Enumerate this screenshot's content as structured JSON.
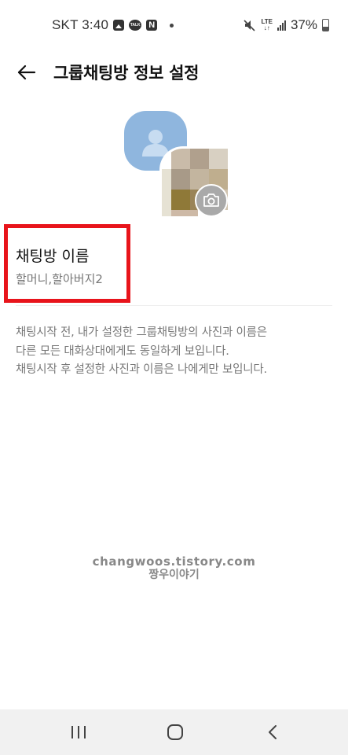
{
  "status_bar": {
    "carrier_time": "SKT 3:40",
    "talk_badge": "TALK",
    "n_badge": "N",
    "network": "LTE",
    "battery": "37%",
    "icons": [
      "gallery-icon",
      "talk-icon",
      "n-icon",
      "mute-icon",
      "lte-icon",
      "signal-icon",
      "battery-icon"
    ]
  },
  "app_bar": {
    "back_icon": "arrow-left-icon",
    "title": "그룹채팅방 정보 설정"
  },
  "profile": {
    "member_icon": "default-profile-icon",
    "camera_icon": "camera-icon"
  },
  "name_field": {
    "label": "채팅방 이름",
    "value": "할머니,할아버지2",
    "highlight_color": "#e8141b"
  },
  "notice": {
    "lines": [
      "채팅시작 전, 내가 설정한 그룹채팅방의 사진과 이름은",
      "다른 모든 대화상대에게도 동일하게 보입니다.",
      "채팅시작 후 설정한 사진과 이름은 나에게만 보입니다."
    ]
  },
  "watermark": {
    "url": "changwoos.tistory.com",
    "name": "짱우이야기"
  },
  "nav_bar": {
    "recents_icon": "recents-icon",
    "home_icon": "home-icon",
    "back_icon": "back-chevron-icon"
  },
  "colors": {
    "avatar_blue": "#8fb6de",
    "text_primary": "#111111",
    "text_secondary": "#777777",
    "nav_background": "#f1f1f1"
  }
}
